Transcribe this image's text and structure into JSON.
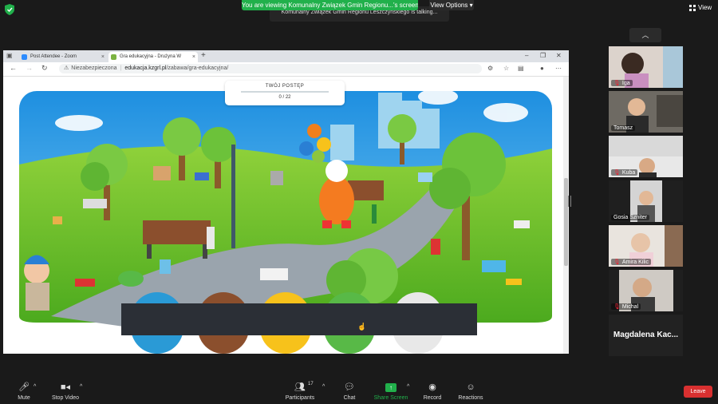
{
  "top": {
    "share_banner": "You are viewing Komunalny Związek Gmin Regionu...'s screen",
    "view_options": "View Options",
    "talking": "Komunalny Związek Gmin Regionu Leszczyńskiego is talking...",
    "view_label": "View"
  },
  "browser": {
    "tabs": [
      {
        "label": "Post Attendee - Zoom",
        "color": "#2d8cff"
      },
      {
        "label": "Gra edukacyjna - Drużyna W",
        "color": "#7cb342"
      }
    ],
    "security_text": "Niezabezpieczona",
    "url_host": "edukacja.kzgrl.pl",
    "url_path": "/zabawa/gra-edukacyjna/"
  },
  "game": {
    "progress_title": "TWÓJ POSTĘP",
    "progress_value": "0 / 22"
  },
  "participants": [
    {
      "name": "Iga",
      "muted": true
    },
    {
      "name": "Tomasz",
      "muted": false
    },
    {
      "name": "Kuba",
      "muted": true
    },
    {
      "name": "Gosia Szniter",
      "muted": false
    },
    {
      "name": "Amira Kilic",
      "muted": true
    },
    {
      "name": "Michal",
      "muted": true
    },
    {
      "name": "Magdalena Kac...",
      "muted": false
    }
  ],
  "toolbar": {
    "mute": "Mute",
    "stop_video": "Stop Video",
    "participants": "Participants",
    "participants_count": "17",
    "chat": "Chat",
    "share_screen": "Share Screen",
    "record": "Record",
    "reactions": "Reactions",
    "leave": "Leave"
  },
  "colors": {
    "share_green": "#21b04b",
    "leave_red": "#d83030"
  }
}
